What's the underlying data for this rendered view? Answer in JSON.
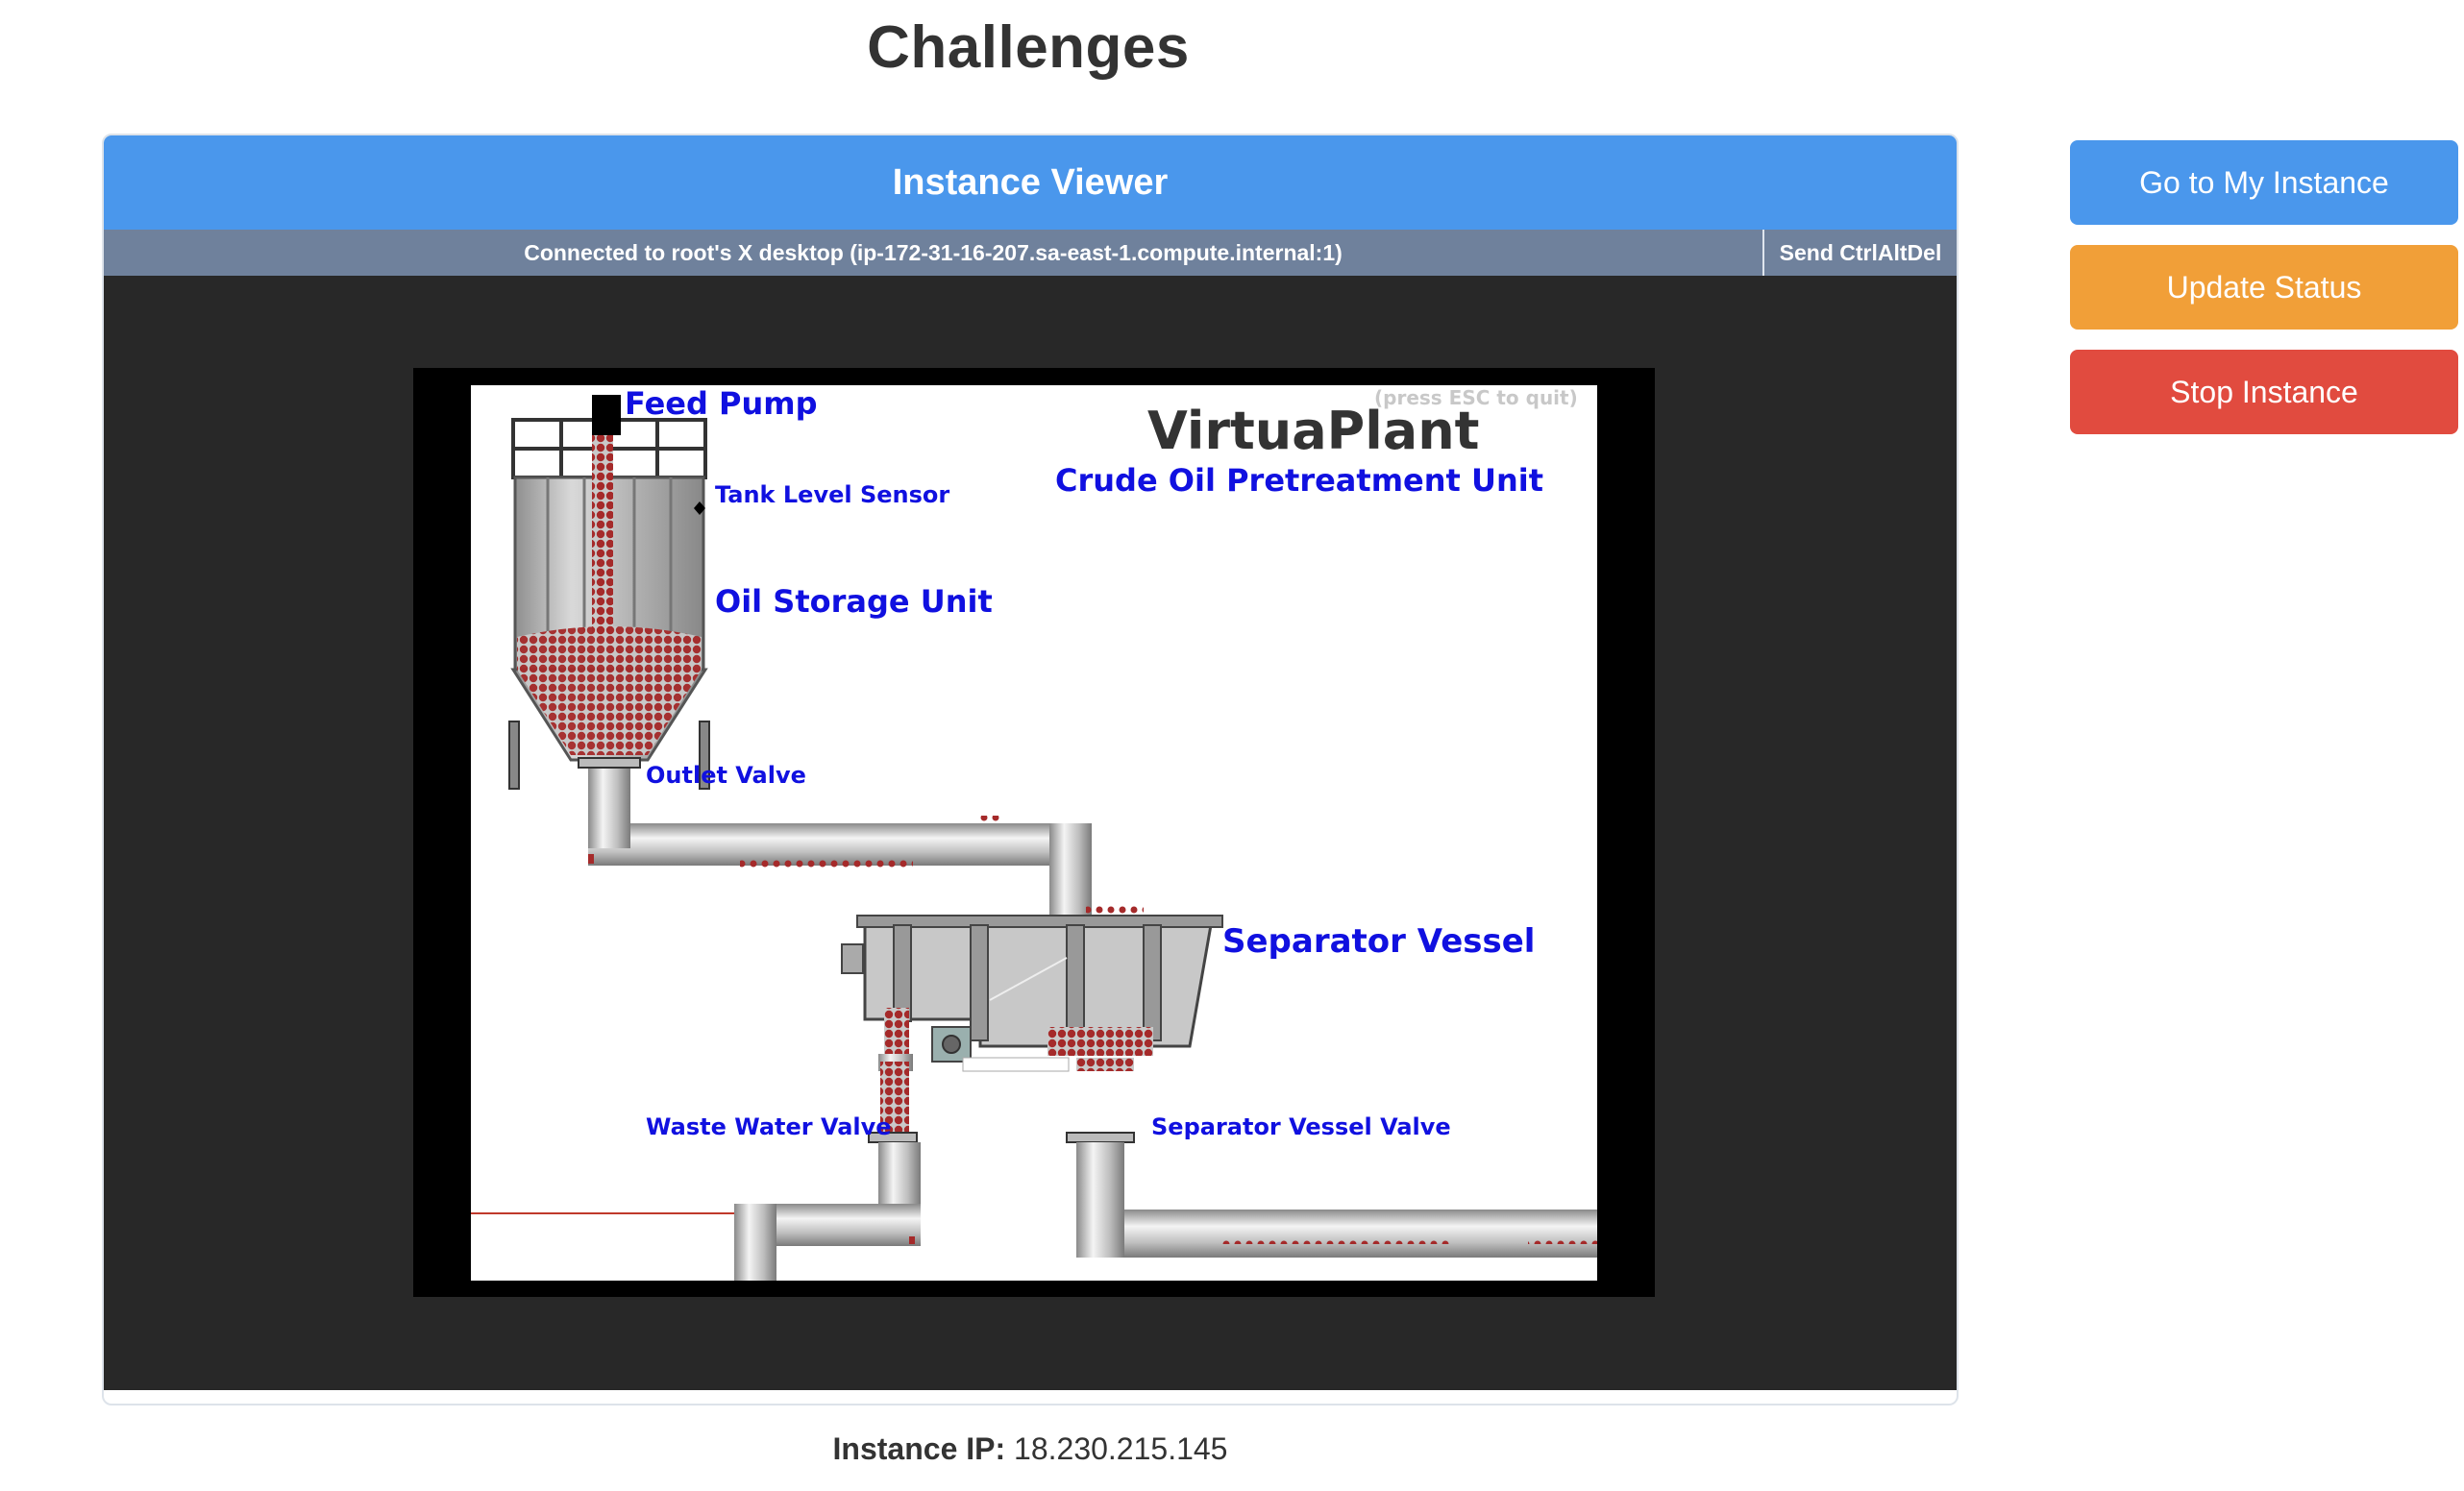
{
  "page": {
    "title": "Challenges"
  },
  "viewer": {
    "title": "Instance Viewer",
    "status": "Connected to root's X desktop (ip-172-31-16-207.sa-east-1.compute.internal:1)",
    "ctrl_alt_del": "Send CtrlAltDel"
  },
  "hmi": {
    "brand": "VirtuaPlant",
    "subtitle": "Crude Oil Pretreatment Unit",
    "esc_hint": "(press ESC to quit)",
    "labels": {
      "feed_pump": "Feed Pump",
      "tank_level_sensor": "Tank Level Sensor",
      "oil_storage_unit": "Oil Storage Unit",
      "outlet_valve": "Outlet Valve",
      "separator_vessel": "Separator Vessel",
      "waste_water_valve": "Waste Water Valve",
      "separator_vessel_valve": "Separator Vessel Valve"
    },
    "colors": {
      "oil": "#a52a2a",
      "pipe": "#c8c8c8",
      "label": "#1010e0"
    }
  },
  "actions": {
    "go_to_instance": "Go to My Instance",
    "update_status": "Update Status",
    "stop_instance": "Stop Instance"
  },
  "instance": {
    "ip_label": "Instance IP:",
    "ip_value": "18.230.215.145"
  }
}
